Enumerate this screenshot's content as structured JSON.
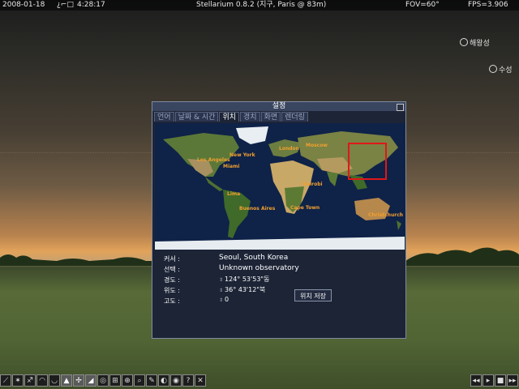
{
  "status_bar": {
    "date": "2008-01-18",
    "time": "4:28:17",
    "app_title": "Stellarium 0.8.2 (지구, Paris @ 83m)",
    "fov": "FOV=60°",
    "fps": "FPS=3.906"
  },
  "sky_labels": {
    "neptune": "해왕성",
    "mercury": "수성"
  },
  "dialog": {
    "title": "설정",
    "tabs": [
      "언어",
      "날짜 & 시간",
      "위치",
      "경치",
      "화면",
      "렌더링"
    ],
    "active_tab": "위치",
    "map": {
      "cities": [
        "New York",
        "London",
        "Moscow",
        "Los Angeles",
        "Miami",
        "Lima",
        "Nairobi",
        "Buenos Aires",
        "Cape Town",
        "Christchurch"
      ]
    },
    "fields": {
      "cursor_label": "커서 :",
      "cursor_value": "Seoul, South Korea",
      "selected_label": "선택 :",
      "selected_value": "Unknown observatory",
      "longitude_label": "경도 :",
      "longitude_value": "124°  53'53\"동",
      "latitude_label": "위도 :",
      "latitude_value": "36°  43'12\"북",
      "altitude_label": "고도 :",
      "altitude_value": "0"
    },
    "save_label": "위치 저장"
  },
  "toolbar": {
    "close_glyph": "✕",
    "help_glyph": "?"
  },
  "colors": {
    "dialog_bg": "#1c2436",
    "city_label": "#f0a030",
    "cursor_box": "#e01818"
  }
}
